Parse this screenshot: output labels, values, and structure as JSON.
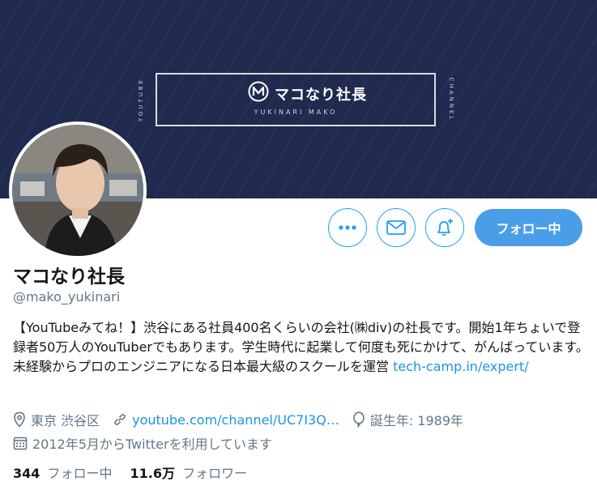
{
  "banner": {
    "title": "マコなり社長",
    "subtitle": "YUKINARI MAKO",
    "side_left": "YOUTUBE",
    "side_right": "CHANNEL",
    "colors": {
      "background": "#1f2a4e",
      "frame": "#d8dcea"
    }
  },
  "actions": {
    "more_icon": "more-icon",
    "message_icon": "mail-icon",
    "notify_icon": "bell-plus-icon",
    "follow_label": "フォロー中",
    "accent": "#1da1f2",
    "follow_bg": "#4a9ee8"
  },
  "profile": {
    "name": "マコなり社長",
    "handle": "@mako_yukinari",
    "bio_text": "【YouTubeみてね！】渋谷にある社員400名くらいの会社(㈱div)の社長です。開始1年ちょいで登録者50万人のYouTuberでもあります。学生時代に起業して何度も死にかけて、がんばっています。 未経験からプロのエンジニアになる日本最大級のスクールを運営 ",
    "bio_link": "tech-camp.in/expert/"
  },
  "meta": {
    "location": "東京 渋谷区",
    "website": "youtube.com/channel/UC7I3Q…",
    "birthday": "誕生年: 1989年",
    "joined": "2012年5月からTwitterを利用しています"
  },
  "stats": {
    "following_count": "344",
    "following_label": "フォロー中",
    "followers_count": "11.6万",
    "followers_label": "フォロワー"
  }
}
